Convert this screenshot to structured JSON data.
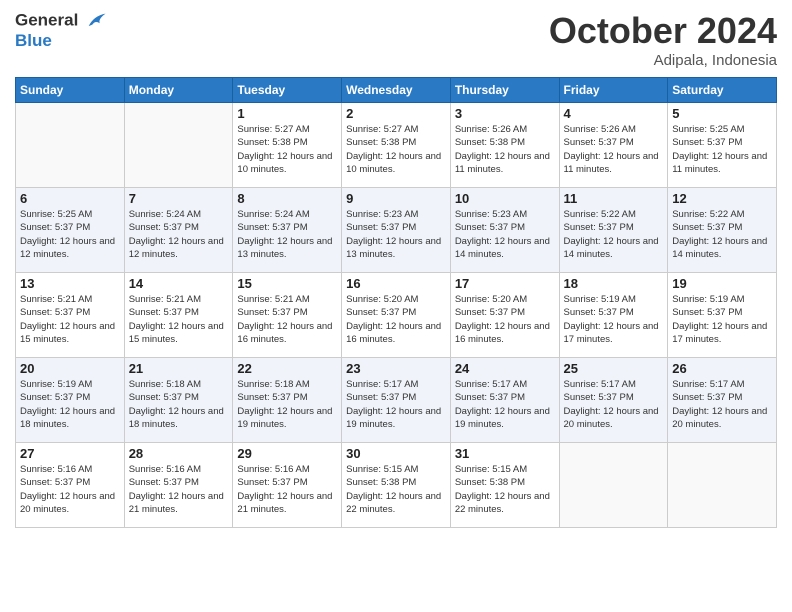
{
  "header": {
    "logo_line1": "General",
    "logo_line2": "Blue",
    "month": "October 2024",
    "location": "Adipala, Indonesia"
  },
  "weekdays": [
    "Sunday",
    "Monday",
    "Tuesday",
    "Wednesday",
    "Thursday",
    "Friday",
    "Saturday"
  ],
  "weeks": [
    [
      {
        "day": "",
        "info": ""
      },
      {
        "day": "",
        "info": ""
      },
      {
        "day": "1",
        "info": "Sunrise: 5:27 AM\nSunset: 5:38 PM\nDaylight: 12 hours and 10 minutes."
      },
      {
        "day": "2",
        "info": "Sunrise: 5:27 AM\nSunset: 5:38 PM\nDaylight: 12 hours and 10 minutes."
      },
      {
        "day": "3",
        "info": "Sunrise: 5:26 AM\nSunset: 5:38 PM\nDaylight: 12 hours and 11 minutes."
      },
      {
        "day": "4",
        "info": "Sunrise: 5:26 AM\nSunset: 5:37 PM\nDaylight: 12 hours and 11 minutes."
      },
      {
        "day": "5",
        "info": "Sunrise: 5:25 AM\nSunset: 5:37 PM\nDaylight: 12 hours and 11 minutes."
      }
    ],
    [
      {
        "day": "6",
        "info": "Sunrise: 5:25 AM\nSunset: 5:37 PM\nDaylight: 12 hours and 12 minutes."
      },
      {
        "day": "7",
        "info": "Sunrise: 5:24 AM\nSunset: 5:37 PM\nDaylight: 12 hours and 12 minutes."
      },
      {
        "day": "8",
        "info": "Sunrise: 5:24 AM\nSunset: 5:37 PM\nDaylight: 12 hours and 13 minutes."
      },
      {
        "day": "9",
        "info": "Sunrise: 5:23 AM\nSunset: 5:37 PM\nDaylight: 12 hours and 13 minutes."
      },
      {
        "day": "10",
        "info": "Sunrise: 5:23 AM\nSunset: 5:37 PM\nDaylight: 12 hours and 14 minutes."
      },
      {
        "day": "11",
        "info": "Sunrise: 5:22 AM\nSunset: 5:37 PM\nDaylight: 12 hours and 14 minutes."
      },
      {
        "day": "12",
        "info": "Sunrise: 5:22 AM\nSunset: 5:37 PM\nDaylight: 12 hours and 14 minutes."
      }
    ],
    [
      {
        "day": "13",
        "info": "Sunrise: 5:21 AM\nSunset: 5:37 PM\nDaylight: 12 hours and 15 minutes."
      },
      {
        "day": "14",
        "info": "Sunrise: 5:21 AM\nSunset: 5:37 PM\nDaylight: 12 hours and 15 minutes."
      },
      {
        "day": "15",
        "info": "Sunrise: 5:21 AM\nSunset: 5:37 PM\nDaylight: 12 hours and 16 minutes."
      },
      {
        "day": "16",
        "info": "Sunrise: 5:20 AM\nSunset: 5:37 PM\nDaylight: 12 hours and 16 minutes."
      },
      {
        "day": "17",
        "info": "Sunrise: 5:20 AM\nSunset: 5:37 PM\nDaylight: 12 hours and 16 minutes."
      },
      {
        "day": "18",
        "info": "Sunrise: 5:19 AM\nSunset: 5:37 PM\nDaylight: 12 hours and 17 minutes."
      },
      {
        "day": "19",
        "info": "Sunrise: 5:19 AM\nSunset: 5:37 PM\nDaylight: 12 hours and 17 minutes."
      }
    ],
    [
      {
        "day": "20",
        "info": "Sunrise: 5:19 AM\nSunset: 5:37 PM\nDaylight: 12 hours and 18 minutes."
      },
      {
        "day": "21",
        "info": "Sunrise: 5:18 AM\nSunset: 5:37 PM\nDaylight: 12 hours and 18 minutes."
      },
      {
        "day": "22",
        "info": "Sunrise: 5:18 AM\nSunset: 5:37 PM\nDaylight: 12 hours and 19 minutes."
      },
      {
        "day": "23",
        "info": "Sunrise: 5:17 AM\nSunset: 5:37 PM\nDaylight: 12 hours and 19 minutes."
      },
      {
        "day": "24",
        "info": "Sunrise: 5:17 AM\nSunset: 5:37 PM\nDaylight: 12 hours and 19 minutes."
      },
      {
        "day": "25",
        "info": "Sunrise: 5:17 AM\nSunset: 5:37 PM\nDaylight: 12 hours and 20 minutes."
      },
      {
        "day": "26",
        "info": "Sunrise: 5:17 AM\nSunset: 5:37 PM\nDaylight: 12 hours and 20 minutes."
      }
    ],
    [
      {
        "day": "27",
        "info": "Sunrise: 5:16 AM\nSunset: 5:37 PM\nDaylight: 12 hours and 20 minutes."
      },
      {
        "day": "28",
        "info": "Sunrise: 5:16 AM\nSunset: 5:37 PM\nDaylight: 12 hours and 21 minutes."
      },
      {
        "day": "29",
        "info": "Sunrise: 5:16 AM\nSunset: 5:37 PM\nDaylight: 12 hours and 21 minutes."
      },
      {
        "day": "30",
        "info": "Sunrise: 5:15 AM\nSunset: 5:38 PM\nDaylight: 12 hours and 22 minutes."
      },
      {
        "day": "31",
        "info": "Sunrise: 5:15 AM\nSunset: 5:38 PM\nDaylight: 12 hours and 22 minutes."
      },
      {
        "day": "",
        "info": ""
      },
      {
        "day": "",
        "info": ""
      }
    ]
  ]
}
